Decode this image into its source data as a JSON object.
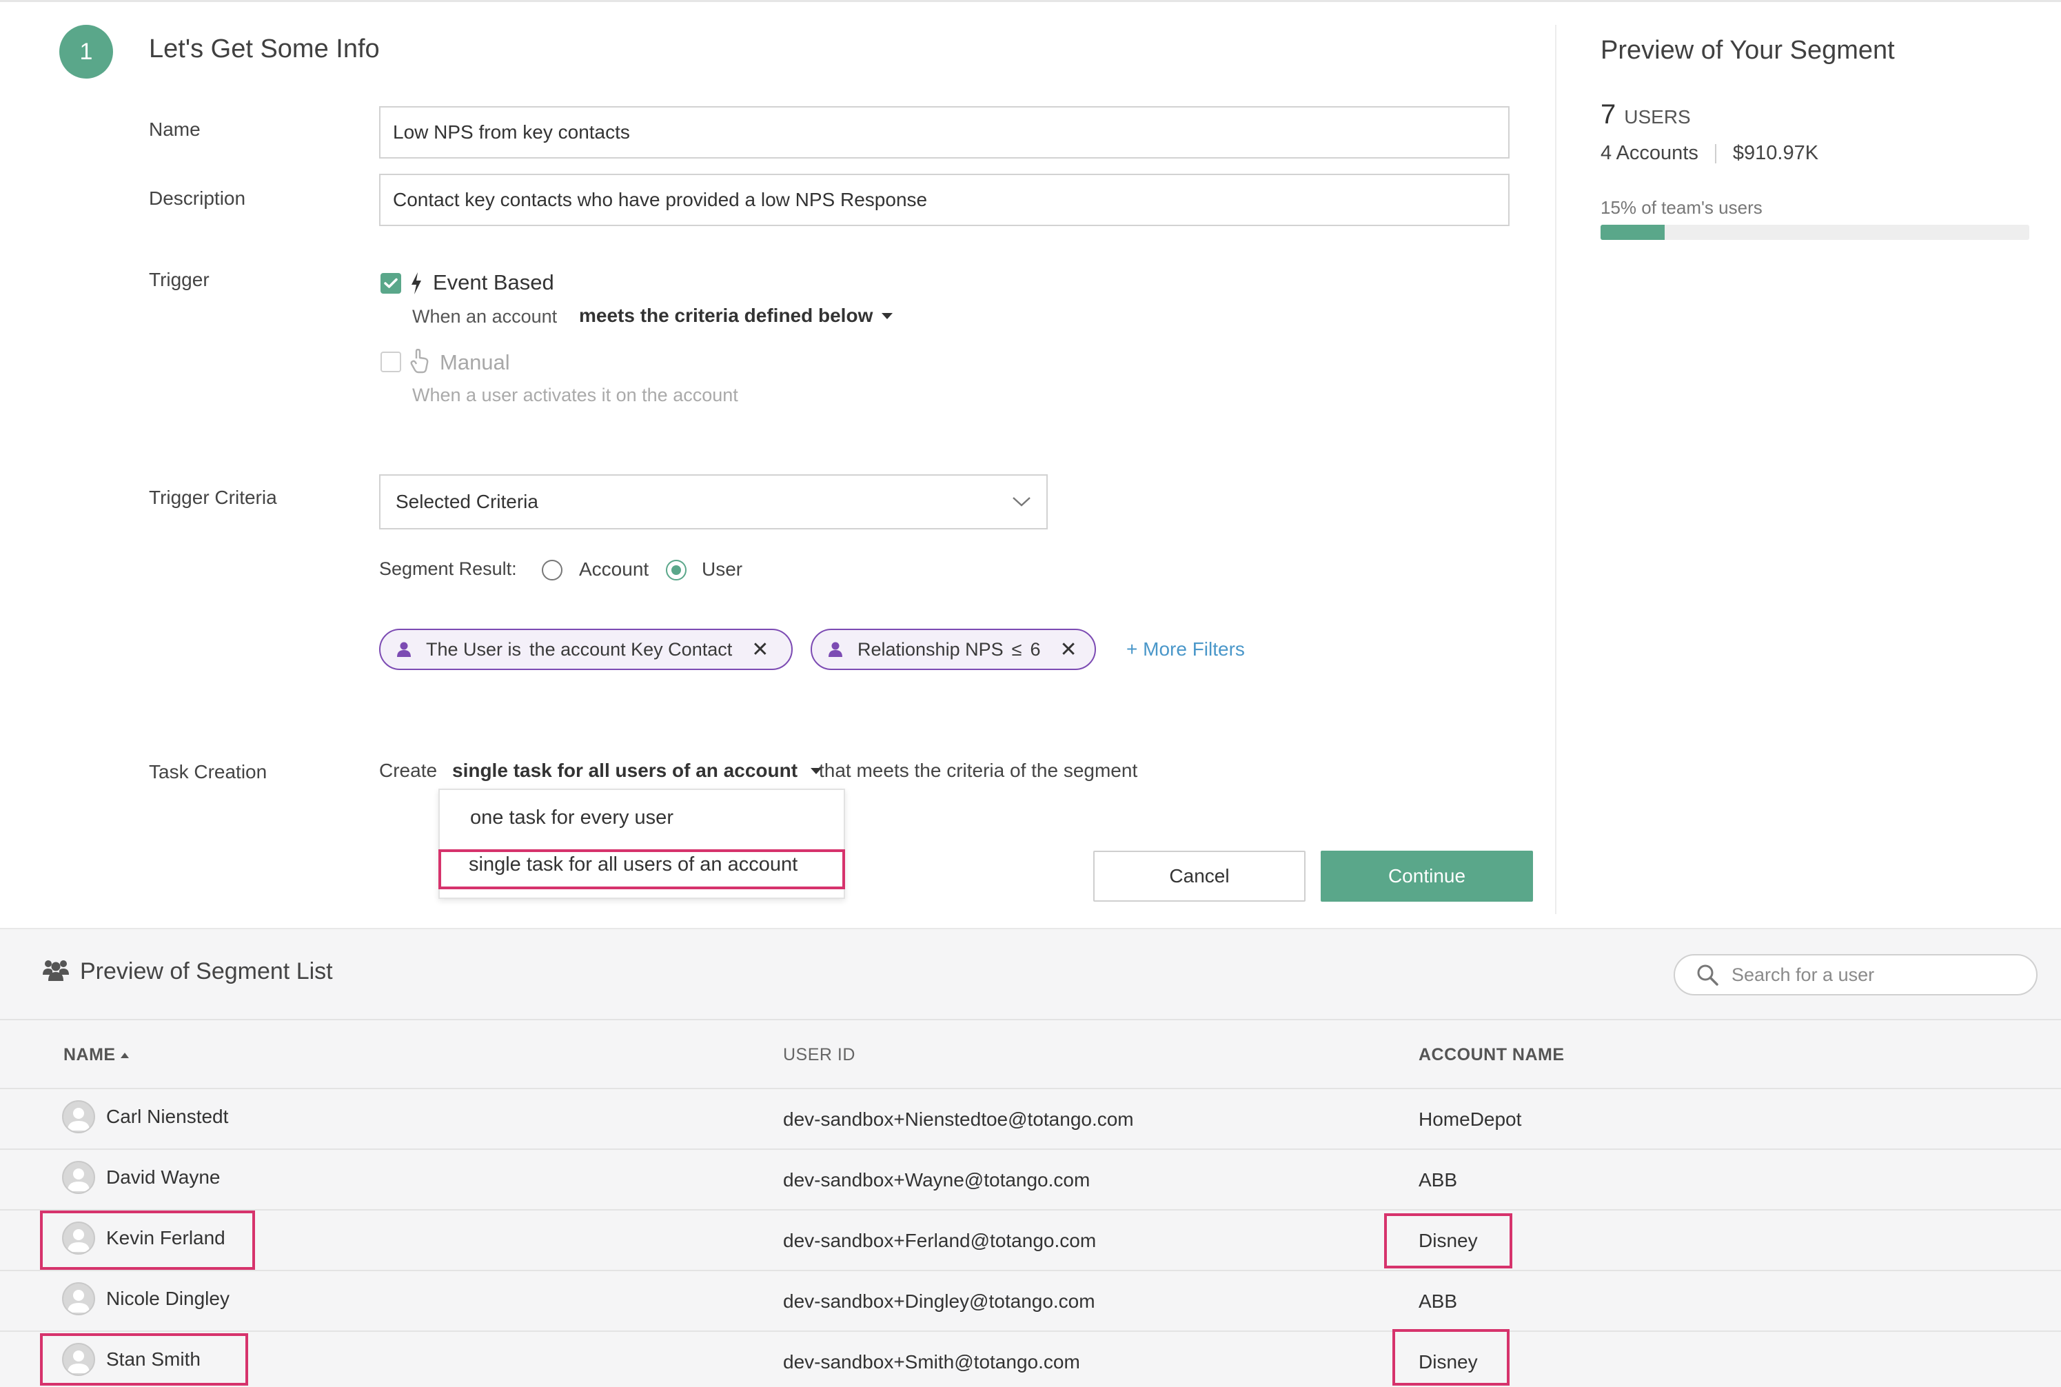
{
  "step": {
    "number": "1",
    "title": "Let's Get Some Info"
  },
  "form": {
    "name_label": "Name",
    "name_value": "Low NPS from key contacts",
    "description_label": "Description",
    "description_value": "Contact key contacts who have provided a low NPS Response",
    "trigger_label": "Trigger",
    "trigger_options": [
      {
        "title": "Event Based",
        "checked": true,
        "desc_prefix": "When an account",
        "desc_dropdown": "meets the criteria defined below"
      },
      {
        "title": "Manual",
        "checked": false,
        "desc": "When a user activates it on the account"
      }
    ],
    "trigger_criteria_label": "Trigger Criteria",
    "criteria_select_value": "Selected Criteria",
    "segment_result_label": "Segment Result:",
    "segment_result_options": [
      "Account",
      "User"
    ],
    "segment_result_selected": "User",
    "filters": [
      {
        "text_prefix": "The User is",
        "text_suffix": "the account Key Contact"
      },
      {
        "text_prefix": "Relationship NPS",
        "operator": "≤",
        "value": "6"
      }
    ],
    "more_filters_link": "+ More Filters",
    "task_creation_label": "Task Creation",
    "task_create_prefix": "Create",
    "task_create_selected": "single task for all users of an account",
    "task_create_suffix": "that meets the criteria of the segment",
    "task_create_menu": [
      "one task for every user",
      "single task for all users of an account"
    ]
  },
  "buttons": {
    "cancel": "Cancel",
    "continue": "Continue"
  },
  "preview": {
    "title": "Preview of Your Segment",
    "users_count": "7",
    "users_label": "USERS",
    "accounts": "4 Accounts",
    "amount": "$910.97K",
    "team_percent_text": "15% of team's users",
    "team_percent": 0.15
  },
  "segment_list": {
    "title": "Preview of Segment List",
    "search_placeholder": "Search for a user",
    "columns": [
      "NAME",
      "USER ID",
      "ACCOUNT NAME"
    ],
    "rows": [
      {
        "name": "Carl Nienstedt",
        "user_id": "dev-sandbox+Nienstedtoe@totango.com",
        "account": "HomeDepot"
      },
      {
        "name": "David Wayne",
        "user_id": "dev-sandbox+Wayne@totango.com",
        "account": "ABB"
      },
      {
        "name": "Kevin Ferland",
        "user_id": "dev-sandbox+Ferland@totango.com",
        "account": "Disney"
      },
      {
        "name": "Nicole Dingley",
        "user_id": "dev-sandbox+Dingley@totango.com",
        "account": "ABB"
      },
      {
        "name": "Stan Smith",
        "user_id": "dev-sandbox+Smith@totango.com",
        "account": "Disney"
      }
    ]
  },
  "colors": {
    "accent_green": "#5aa78a",
    "filter_purple": "#7c4bb3",
    "link_blue": "#4a97c9",
    "highlight_pink": "#d6336c"
  }
}
